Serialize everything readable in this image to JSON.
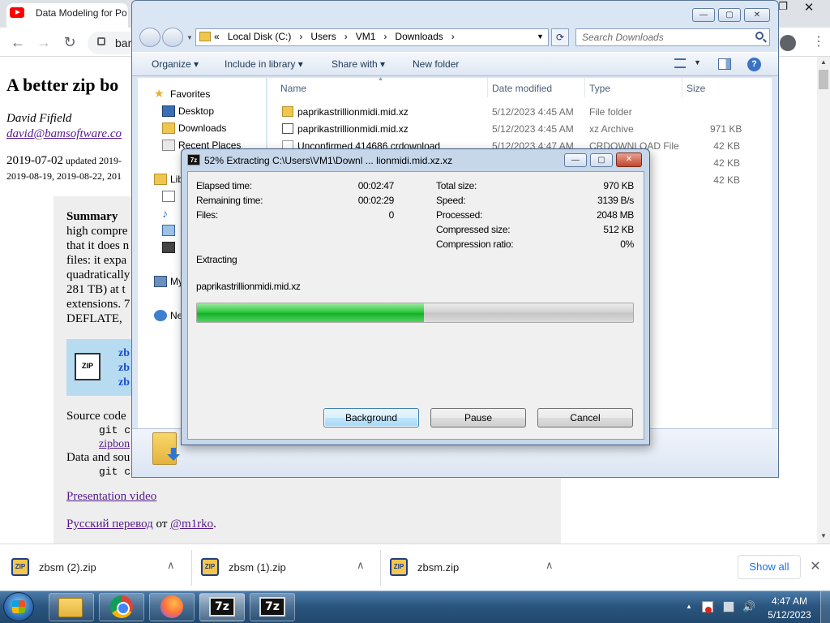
{
  "chrome": {
    "tab_title": "Data Modeling for Po",
    "omnibox_text": "bam",
    "restore_glyph": "❐",
    "close_glyph": "✕",
    "back_glyph": "←",
    "forward_glyph": "→",
    "reload_glyph": "↻",
    "menu_glyph": "⋮"
  },
  "webpage": {
    "title": "A better zip bo",
    "author": "David Fifield",
    "email": "david@bamsoftware.co",
    "date_main": "2019-07-02",
    "date_updated": " updated 2019-",
    "date_line2": "2019-08-19, 2019-08-22, 201",
    "summary_heading": "Summary",
    "summary_lines": [
      "high compre",
      "that it does n",
      "files: it expa",
      "quadratically",
      "281 TB) at t",
      "extensions. 7",
      "DEFLATE, "
    ],
    "zip_links": [
      "zb",
      "zb",
      "zb"
    ],
    "source_code": "Source code",
    "git_clone": "git cl",
    "zipbomb_link": "zipbon",
    "data_sources": "Data and sou",
    "presentation_video": "Presentation video",
    "russian_link": "Русский перевод",
    "russian_from": " от ",
    "russian_author": "@m1rko",
    "russian_end": "."
  },
  "downloads": {
    "items": [
      {
        "name": "zbsm (2).zip"
      },
      {
        "name": "zbsm (1).zip"
      },
      {
        "name": "zbsm.zip"
      }
    ],
    "chevron": "∧",
    "show_all": "Show all",
    "close_glyph": "✕"
  },
  "explorer": {
    "address_crumbs": [
      "«",
      "Local Disk (C:)",
      "›",
      "Users",
      "›",
      "VM1",
      "›",
      "Downloads",
      "›"
    ],
    "search_placeholder": "Search Downloads",
    "commands": {
      "organize": "Organize ▾",
      "include": "Include in library ▾",
      "share": "Share with ▾",
      "new_folder": "New folder"
    },
    "win_buttons": {
      "min": "—",
      "max": "▢",
      "close": "✕"
    },
    "refresh_glyph": "⟳",
    "nav": {
      "favorites": "Favorites",
      "desktop": "Desktop",
      "downloads": "Downloads",
      "recent": "Recent Places",
      "libraries": "Lib",
      "computer": "My",
      "network": "Ne"
    },
    "columns": {
      "name": "Name",
      "date": "Date modified",
      "type": "Type",
      "size": "Size"
    },
    "files": [
      {
        "name": "paprikastrillionmidi.mid.xz",
        "date": "5/12/2023 4:45 AM",
        "type": "File folder",
        "size": ""
      },
      {
        "name": "paprikastrillionmidi.mid.xz",
        "date": "5/12/2023 4:45 AM",
        "type": "xz Archive",
        "size": "971 KB"
      },
      {
        "name": "Unconfirmed 414686.crdownload",
        "date": "5/12/2023 4:47 AM",
        "type": "CRDOWNLOAD File",
        "size": "42 KB"
      },
      {
        "name": "",
        "date": "",
        "type": "D File",
        "size": "42 KB"
      },
      {
        "name": "",
        "date": "",
        "type": "D File",
        "size": "42 KB"
      }
    ]
  },
  "dialog": {
    "icon_text": "7z",
    "title": "52% Extracting C:\\Users\\VM1\\Downl ... lionmidi.mid.xz.xz",
    "win_buttons": {
      "min": "—",
      "max": "▢",
      "close": "✕"
    },
    "left_stats": [
      {
        "label": "Elapsed time:",
        "value": "00:02:47"
      },
      {
        "label": "Remaining time:",
        "value": "00:02:29"
      },
      {
        "label": "Files:",
        "value": "0"
      }
    ],
    "right_stats": [
      {
        "label": "Total size:",
        "value": "970 KB"
      },
      {
        "label": "Speed:",
        "value": "3139 B/s"
      },
      {
        "label": "Processed:",
        "value": "2048 MB"
      },
      {
        "label": "Compressed size:",
        "value": "512 KB"
      },
      {
        "label": "Compression ratio:",
        "value": "0%"
      }
    ],
    "status": "Extracting",
    "current_file": "paprikastrillionmidi.mid.xz",
    "progress_percent": 52,
    "buttons": {
      "background": "Background",
      "pause": "Pause",
      "cancel": "Cancel"
    }
  },
  "taskbar": {
    "sevenzip_label": "7z",
    "tray_arrow": "▲",
    "time": "4:47 AM",
    "date": "5/12/2023"
  }
}
